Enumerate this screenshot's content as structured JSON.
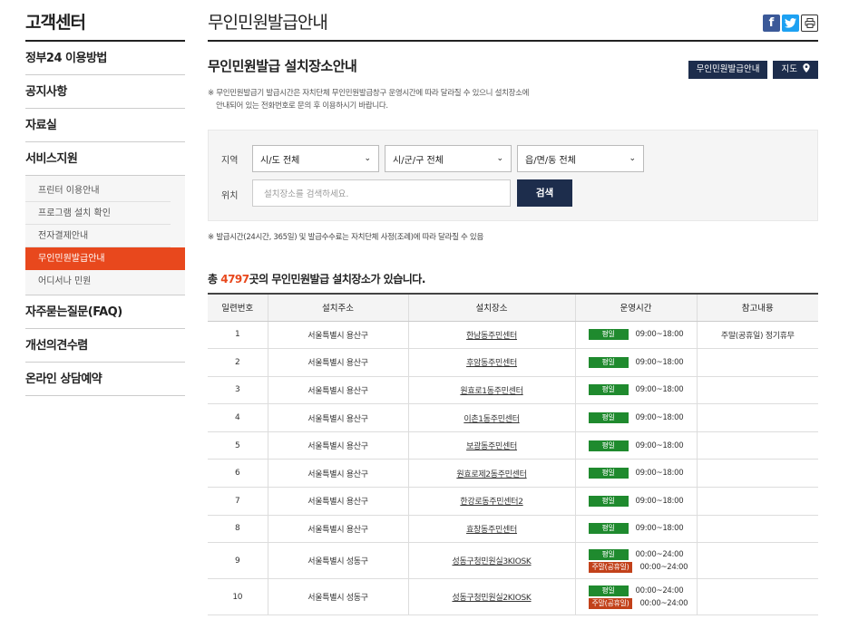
{
  "sidebar": {
    "title": "고객센터",
    "items": [
      {
        "label": "정부24 이용방법"
      },
      {
        "label": "공지사항"
      },
      {
        "label": "자료실"
      },
      {
        "label": "서비스지원"
      }
    ],
    "sub_items": [
      {
        "label": "프린터 이용안내"
      },
      {
        "label": "프로그램 설치 확인"
      },
      {
        "label": "전자결제안내"
      },
      {
        "label": "무인민원발급안내"
      },
      {
        "label": "어디서나 민원"
      }
    ],
    "bottom_items": [
      {
        "label": "자주묻는질문(FAQ)"
      },
      {
        "label": "개선의견수렴"
      },
      {
        "label": "온라인 상담예약"
      }
    ]
  },
  "page": {
    "title": "무인민원발급안내",
    "section_title": "무인민원발급 설치장소안내",
    "btn_guide": "무인민원발급안내",
    "btn_map": "지도",
    "notice_line1": "※ 무인민원발급기 발급시간은 자치단체 무인민원발급창구 운영시간에 따라 달라질 수 있으니 설치장소에",
    "notice_line2": "안내되어 있는 전화번호로 문의 후 이용하시기 바랍니다.",
    "note2": "※ 발급시간(24시간, 365일) 및 발급수수료는 자치단체 사정(조례)에 따라 달라질 수 있음",
    "total_prefix": "총 ",
    "total_count": "4797",
    "total_suffix": "곳의 무인민원발급 설치장소가 있습니다."
  },
  "search": {
    "region_label": "지역",
    "sido": "시/도 전체",
    "sigungu": "시/군/구 전체",
    "eupmyeondong": "읍/면/동 전체",
    "location_label": "위치",
    "placeholder": "설치장소를 검색하세요.",
    "button": "검색"
  },
  "table": {
    "headers": [
      "일련번호",
      "설치주소",
      "설치장소",
      "운영시간",
      "참고내용"
    ],
    "weekday_badge": "평일",
    "weekend_badge": "주말(공휴일)",
    "rows": [
      {
        "no": "1",
        "address": "서울특별시 용산구",
        "place": "한남동주민센터",
        "weekday": "09:00~18:00",
        "weekend": "",
        "note": "주말(공휴일) 정기휴무"
      },
      {
        "no": "2",
        "address": "서울특별시 용산구",
        "place": "후암동주민센터",
        "weekday": "09:00~18:00",
        "weekend": "",
        "note": ""
      },
      {
        "no": "3",
        "address": "서울특별시 용산구",
        "place": "원효로1동주민센터",
        "weekday": "09:00~18:00",
        "weekend": "",
        "note": ""
      },
      {
        "no": "4",
        "address": "서울특별시 용산구",
        "place": "이촌1동주민센터",
        "weekday": "09:00~18:00",
        "weekend": "",
        "note": ""
      },
      {
        "no": "5",
        "address": "서울특별시 용산구",
        "place": "보광동주민센터",
        "weekday": "09:00~18:00",
        "weekend": "",
        "note": ""
      },
      {
        "no": "6",
        "address": "서울특별시 용산구",
        "place": "원효로제2동주민센터",
        "weekday": "09:00~18:00",
        "weekend": "",
        "note": ""
      },
      {
        "no": "7",
        "address": "서울특별시 용산구",
        "place": "한강로동주민센터2",
        "weekday": "09:00~18:00",
        "weekend": "",
        "note": ""
      },
      {
        "no": "8",
        "address": "서울특별시 용산구",
        "place": "효창동주민센터",
        "weekday": "09:00~18:00",
        "weekend": "",
        "note": ""
      },
      {
        "no": "9",
        "address": "서울특별시 성동구",
        "place": "성동구청민원실3KIOSK",
        "weekday": "00:00~24:00",
        "weekend": "00:00~24:00",
        "note": ""
      },
      {
        "no": "10",
        "address": "서울특별시 성동구",
        "place": "성동구청민원실2KIOSK",
        "weekday": "00:00~24:00",
        "weekend": "00:00~24:00",
        "note": ""
      }
    ]
  },
  "icons": {
    "facebook": "facebook-icon",
    "twitter": "twitter-icon",
    "print": "print-icon",
    "map_pin": "map-pin-icon",
    "chevron": "chevron-down-icon"
  },
  "colors": {
    "accent": "#e8481d",
    "navy": "#1d2d4c",
    "weekday_green": "#1f8a2e",
    "weekend_red": "#c2411a"
  }
}
